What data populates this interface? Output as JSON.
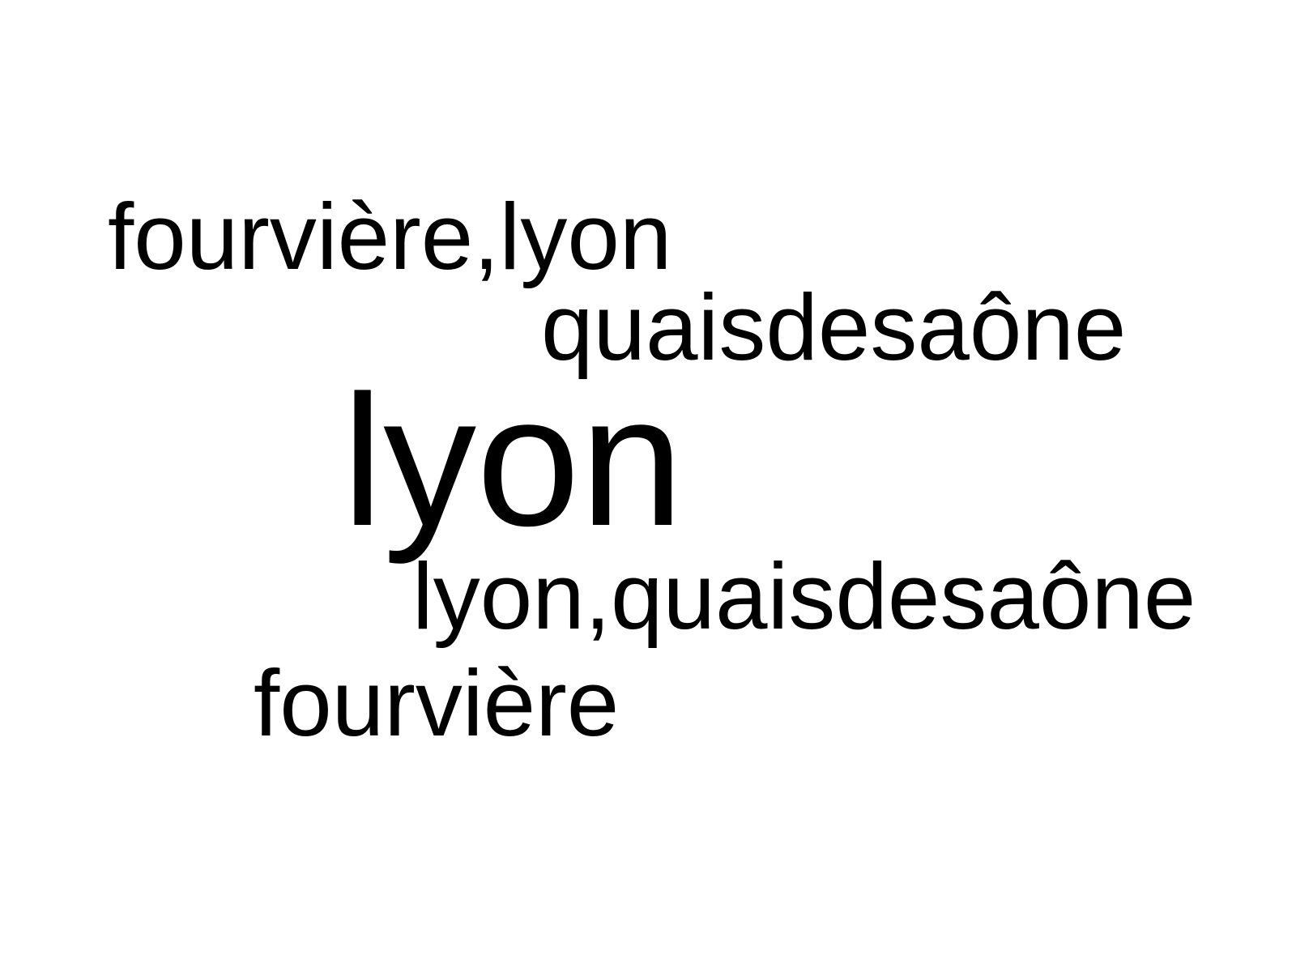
{
  "word_cloud": {
    "words": [
      {
        "text": "fourvière,lyon",
        "weight": 1
      },
      {
        "text": "quaisdesaône",
        "weight": 1
      },
      {
        "text": "lyon",
        "weight": 2
      },
      {
        "text": "lyon,quaisdesaône",
        "weight": 1
      },
      {
        "text": "fourvière",
        "weight": 1
      }
    ]
  },
  "colors": {
    "background": "#ffffff",
    "text": "#000000"
  }
}
